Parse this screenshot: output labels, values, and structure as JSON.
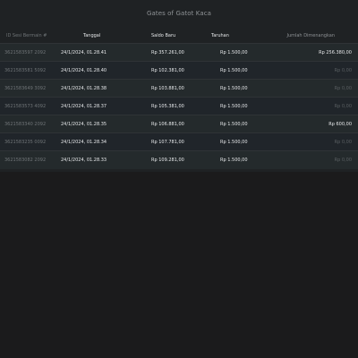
{
  "page": {
    "title": "Gates of Gatot Kaca"
  },
  "table": {
    "headers": {
      "id": "ID Sesi Bermain #",
      "date": "Tanggal",
      "balance": "Saldo Baru",
      "bet": "Taruhan",
      "win": "Jumlah Dimenangkan"
    },
    "rows": [
      {
        "id": "3621583597 2092",
        "date": "24/1/2024, 01.28.41",
        "balance": "Rp 357.261,00",
        "bet": "Rp 1.500,00",
        "win": "Rp 256.380,00"
      },
      {
        "id": "3621583581 5092",
        "date": "24/1/2024, 01.28.40",
        "balance": "Rp 102.381,00",
        "bet": "Rp 1.500,00",
        "win": "Rp 0,00"
      },
      {
        "id": "3621583649 3092",
        "date": "24/1/2024, 01.28.38",
        "balance": "Rp 103.881,00",
        "bet": "Rp 1.500,00",
        "win": "Rp 0,00"
      },
      {
        "id": "3621583573 4092",
        "date": "24/1/2024, 01.28.37",
        "balance": "Rp 105.381,00",
        "bet": "Rp 1.500,00",
        "win": "Rp 0,00"
      },
      {
        "id": "3621583340 2092",
        "date": "24/1/2024, 01.28.35",
        "balance": "Rp 106.881,00",
        "bet": "Rp 1.500,00",
        "win": "Rp 600,00"
      },
      {
        "id": "3621583235 0092",
        "date": "24/1/2024, 01.28.34",
        "balance": "Rp 107.781,00",
        "bet": "Rp 1.500,00",
        "win": "Rp 0,00"
      },
      {
        "id": "3621583082 2092",
        "date": "24/1/2024, 01.28.33",
        "balance": "Rp 109.281,00",
        "bet": "Rp 1.500,00",
        "win": "Rp 0,00"
      }
    ]
  }
}
